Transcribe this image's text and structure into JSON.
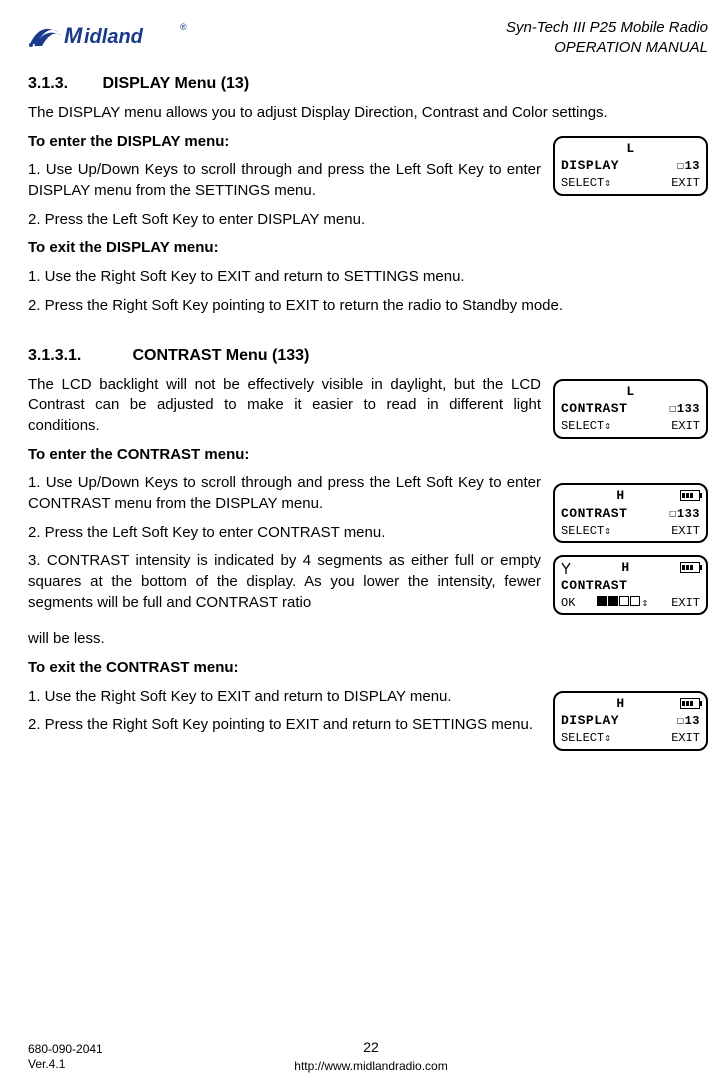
{
  "header": {
    "brand": "Midland",
    "title_line1": "Syn-Tech III P25 Mobile Radio",
    "title_line2": "OPERATION MANUAL"
  },
  "section1": {
    "number": "3.1.3.",
    "title": "DISPLAY Menu (13)",
    "intro": "The DISPLAY menu allows you to adjust Display Direction, Contrast and Color settings.",
    "enter_heading": "To enter the DISPLAY menu:",
    "enter_step1": "1. Use Up/Down Keys to scroll through and press the Left Soft Key to enter DISPLAY menu from the SETTINGS menu.",
    "enter_step2": "2. Press the Left Soft Key to enter DISPLAY menu.",
    "exit_heading": "To exit the DISPLAY menu:",
    "exit_step1": "1. Use the Right Soft Key to EXIT and return to SETTINGS menu.",
    "exit_step2": "2. Press the Right Soft Key pointing to EXIT to return the radio to Standby mode."
  },
  "section2": {
    "number": "3.1.3.1.",
    "title": "CONTRAST Menu (133)",
    "intro": "The LCD backlight will not be effectively visible in daylight, but the LCD Contrast can be adjusted to make it easier to read in different light conditions.",
    "enter_heading": "To enter the CONTRAST menu:",
    "enter_step1": "1. Use Up/Down Keys to scroll through and press the Left Soft Key to enter CONTRAST menu from the DISPLAY menu.",
    "enter_step2": "2. Press the Left Soft Key to enter CONTRAST menu.",
    "enter_step3": "3. CONTRAST intensity is indicated by 4 segments as either full or empty squares at the bottom of the display. As you lower the intensity, fewer segments will be full and CONTRAST ratio",
    "enter_step3b": "will be less.",
    "exit_heading": "To exit the CONTRAST menu:",
    "exit_step1": "1. Use the Right Soft Key to EXIT and return to DISPLAY menu.",
    "exit_step2": "2. Press the Right Soft Key pointing to EXIT and return to SETTINGS menu."
  },
  "lcd1": {
    "top": "L",
    "code": "☐13",
    "main": "DISPLAY",
    "bl": "SELECT",
    "br": "EXIT"
  },
  "lcd2": {
    "top": "L",
    "code": "☐133",
    "main": "CONTRAST",
    "bl": "SELECT",
    "br": "EXIT"
  },
  "lcd3": {
    "top": "H",
    "code": "☐133",
    "main": "CONTRAST",
    "bl": "SELECT",
    "br": "EXIT"
  },
  "lcd4": {
    "top": "H",
    "main": "CONTRAST",
    "bl": "OK",
    "br": "EXIT"
  },
  "lcd5": {
    "top": "H",
    "code": "☐13",
    "main": "DISPLAY",
    "bl": "SELECT",
    "br": "EXIT"
  },
  "footer": {
    "docnum": "680-090-2041",
    "ver": "Ver.4.1",
    "page": "22",
    "url": "http://www.midlandradio.com"
  }
}
